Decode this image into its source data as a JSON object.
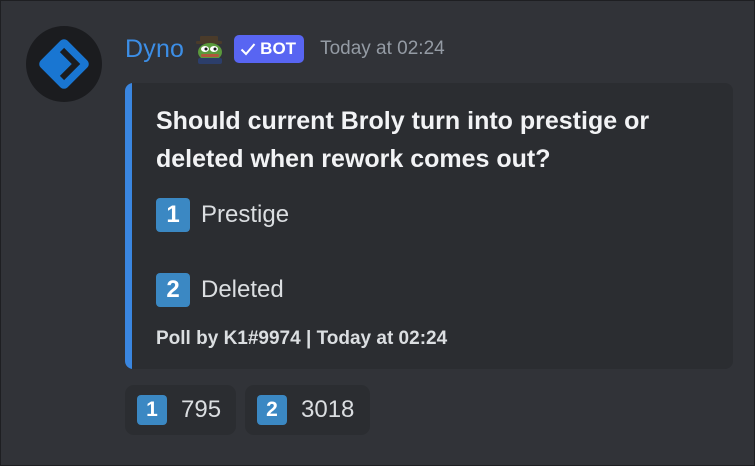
{
  "message": {
    "author": "Dyno",
    "author_emoji": "pepe-detective-emoji",
    "bot_tag": "BOT",
    "timestamp": "Today at 02:24"
  },
  "embed": {
    "accent_color": "#3a86e0",
    "title": "Should current Broly turn into prestige or deleted when rework comes out?",
    "options": [
      {
        "key": "1",
        "label": "Prestige"
      },
      {
        "key": "2",
        "label": "Deleted"
      }
    ],
    "footer": "Poll by K1#9974 | Today at 02:24"
  },
  "reactions": [
    {
      "emoji": "1",
      "count": "795"
    },
    {
      "emoji": "2",
      "count": "3018"
    }
  ]
}
